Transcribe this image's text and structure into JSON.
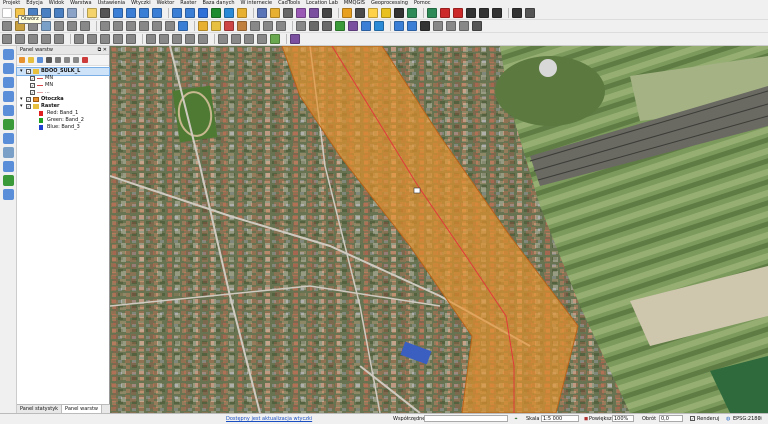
{
  "menubar": {
    "items": [
      "Projekt",
      "Edycja",
      "Widok",
      "Warstwa",
      "Ustawienia",
      "Wtyczki",
      "Wektor",
      "Raster",
      "Baza danych",
      "W internecie",
      "CadTools",
      "Location Lab",
      "MMQGIS",
      "Geoprocessing",
      "Pomoc"
    ]
  },
  "tooltip": {
    "text": "Otwórz"
  },
  "toolbars": {
    "row1_colors": [
      "#ffffff",
      "#f3c54c",
      "#4a7fc1",
      "#4a7fc1",
      "#4a7fc1",
      "#8aa3c7",
      "#f3d36a",
      "#555555",
      "#3a7fd5",
      "#3a7fd5",
      "#3a7fd5",
      "#3a7fd5",
      "#3a7fd5",
      "#3a7fd5",
      "#2f6fd8",
      "#1c8a2e",
      "#2a8ad6",
      "#e8b030",
      "#5a74b8",
      "#e8b030",
      "#666666",
      "#9b59b6",
      "#7a4fa0",
      "#444444",
      "#e8a020",
      "#4a4a4a",
      "#ffd24a",
      "#e8c020",
      "#333333",
      "#2e8b57",
      "#2e8b57",
      "#cc2a2a",
      "#cc2a2a",
      "#333333",
      "#333333",
      "#333333",
      "#333333",
      "#555555"
    ],
    "row2_colors": [
      "#888888",
      "#c8a040",
      "#888888",
      "#7aa0c8",
      "#888888",
      "#888888",
      "#888888",
      "#888888",
      "#888888",
      "#888888",
      "#888888",
      "#888888",
      "#888888",
      "#3a7fd5",
      "#e8b030",
      "#e8c040",
      "#cc4444",
      "#c08040",
      "#888888",
      "#888888",
      "#888888",
      "#888888",
      "#6a6a6a",
      "#6a6a6a",
      "#3a9a3a",
      "#7a4fa0",
      "#3a7fd5",
      "#2a8ad6",
      "#3a7fd5",
      "#3a7fd5",
      "#333333",
      "#888888",
      "#888888",
      "#888888",
      "#555555"
    ],
    "row3_colors": [
      "#888888",
      "#888888",
      "#888888",
      "#888888",
      "#888888",
      "#888888",
      "#888888",
      "#888888",
      "#888888",
      "#888888",
      "#888888",
      "#888888",
      "#888888",
      "#888888",
      "#888888",
      "#888888",
      "#888888",
      "#888888",
      "#888888",
      "#6aa84f",
      "#7a4fa0"
    ]
  },
  "left_tools_colors": [
    "#5a8ed8",
    "#5a8ed8",
    "#5a8ed8",
    "#5a8ed8",
    "#5a8ed8",
    "#3a9a3a",
    "#5a8ed8",
    "#7aa0c8",
    "#5a8ed8",
    "#3a9a3a",
    "#5a8ed8"
  ],
  "panel": {
    "title": "Panel warstw",
    "close_label": "✕",
    "float_label": "⧉",
    "layers": [
      {
        "label": "BDOO_SULK_L",
        "type": "group",
        "checked": true,
        "selected": true
      },
      {
        "label": "MN",
        "type": "line",
        "color": "#d94848",
        "checked": true
      },
      {
        "label": "MN",
        "type": "line",
        "color": "#d94848",
        "checked": true
      },
      {
        "label": "...",
        "type": "line",
        "color": "#e0a0a0",
        "checked": true
      },
      {
        "label": "Otoczka",
        "type": "fill",
        "color": "#e8922e",
        "checked": true
      },
      {
        "label": "Raster",
        "type": "group",
        "checked": true
      },
      {
        "label": "Red: Band_1",
        "type": "band",
        "color": "#e02020"
      },
      {
        "label": "Green: Band_2",
        "type": "band",
        "color": "#20a020"
      },
      {
        "label": "Blue: Band_3",
        "type": "band",
        "color": "#2040d0"
      }
    ],
    "tabs": [
      "Panel statystyk",
      "Panel warstw"
    ],
    "active_tab": 1
  },
  "status": {
    "update_link": "Dostępny jest aktualizacja wtyczki",
    "coord_label": "Współrzędne",
    "coord_value": "",
    "scale_label": "Skala",
    "scale_value": "1:5 000",
    "magnifier_label": "Powiększenie",
    "magnifier_value": "100%",
    "rotation_label": "Obrót",
    "rotation_value": "0,0",
    "render_label": "Renderuj",
    "epsg_label": "EPSG:2180",
    "render_checked": true
  },
  "map": {
    "buffer_color": "#e8922e",
    "centerline_color": "#e03a3a",
    "railway_color": "#5a5a5a"
  }
}
